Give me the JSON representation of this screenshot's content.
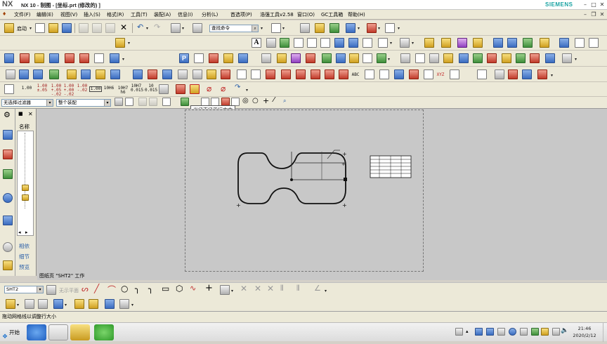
{
  "titlebar": {
    "logo": "NX",
    "title": "NX 10 - 制图 - [坐标.prt (修改的) ]",
    "brand": "SIEMENS"
  },
  "menubar": {
    "items": [
      "文件(F)",
      "编辑(E)",
      "视图(V)",
      "插入(S)",
      "格式(R)",
      "工具(T)",
      "装配(A)",
      "信息(I)",
      "分析(L)",
      "首选项(P)",
      "浩强工具v2.58",
      "窗口(O)",
      "GC工具箱",
      "帮助(H)"
    ]
  },
  "toolbar": {
    "start_label": "启动",
    "command_search_placeholder": "查找命令",
    "number_buttons": [
      "1.00",
      "1.00 ±.05",
      "1.00 +.05 -.02",
      "1.00 +.00 -.02",
      "1.00 -.02",
      "1.00",
      "10H6",
      "10H7 h6",
      "10H7 0.015",
      "10 0.015"
    ],
    "abc_label": "ABC",
    "xyz_label": "XYZ"
  },
  "filter_row": {
    "selection_filter": "无选择过滤器",
    "assembly_scope": "整个装配"
  },
  "tooltip": "半径直径平行文本",
  "navigator": {
    "header": "名称",
    "labels": [
      "相依",
      "细节",
      "预览"
    ]
  },
  "status_line": "图纸页 \"SHT2\" 工作",
  "bottom_toolbar": {
    "sheet_combo": "SHT2",
    "grayed_text": "无示平面"
  },
  "cue_line": "拖动网格线以调整行大小",
  "taskbar": {
    "start_label": "开始",
    "time": "21:46",
    "date": "2020/2/12"
  },
  "colors": {
    "canvas_bg": "#c8c8c8",
    "chrome_bg": "#ece9d8",
    "brand": "#1aa3a3"
  }
}
